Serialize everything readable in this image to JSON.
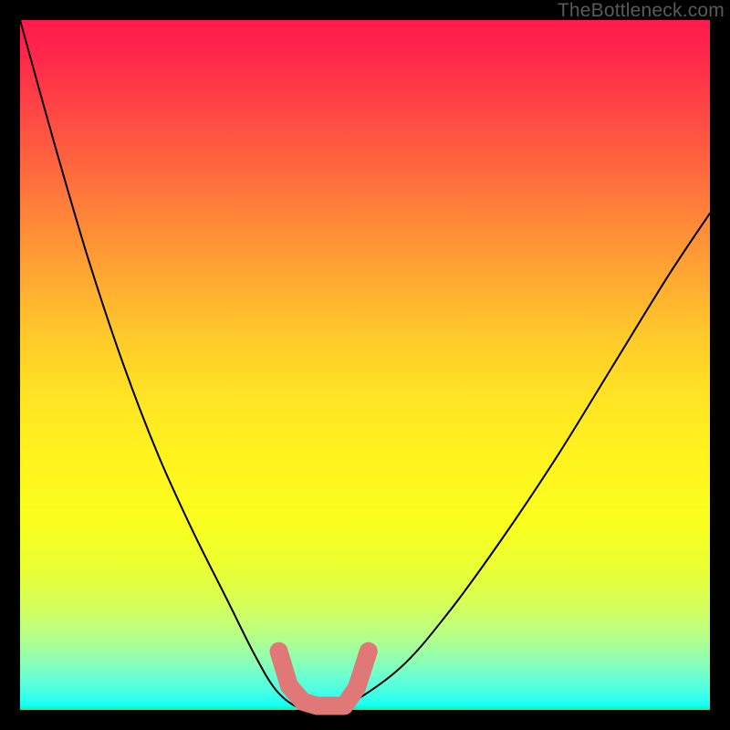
{
  "watermark": "TheBottleneck.com",
  "colors": {
    "background": "#000000",
    "curve": "#000000",
    "marker": "#e17878",
    "watermark": "#5a5a5a"
  },
  "chart_data": {
    "type": "line",
    "title": "",
    "xlabel": "",
    "ylabel": "",
    "xlim": [
      0,
      100
    ],
    "ylim": [
      0,
      100
    ],
    "grid": false,
    "legend": false,
    "series": [
      {
        "name": "bottleneck-curve",
        "x": [
          0,
          5,
          10,
          15,
          20,
          25,
          30,
          34,
          37,
          40,
          43,
          47,
          55,
          62,
          70,
          78,
          86,
          94,
          100
        ],
        "y": [
          100,
          82,
          65,
          50,
          37,
          26,
          16,
          8,
          3,
          0.5,
          0,
          0.5,
          6,
          14,
          25,
          37,
          50,
          63,
          72
        ]
      }
    ],
    "annotations": [
      {
        "name": "optimal-range-marker",
        "type": "polyline",
        "x": [
          37.5,
          39,
          41,
          43,
          47,
          48.8,
          50.5
        ],
        "y": [
          8.5,
          3.5,
          1.2,
          0.6,
          0.6,
          3.2,
          8.5
        ],
        "stroke": "#e17878"
      }
    ],
    "background": {
      "type": "vertical-gradient",
      "stops": [
        {
          "pos": 0.0,
          "color": "#ff1a4d"
        },
        {
          "pos": 0.3,
          "color": "#ff8b37"
        },
        {
          "pos": 0.55,
          "color": "#ffe524"
        },
        {
          "pos": 0.8,
          "color": "#eaff34"
        },
        {
          "pos": 0.93,
          "color": "#8cffb6"
        },
        {
          "pos": 1.0,
          "color": "#03f7a5"
        }
      ]
    }
  }
}
